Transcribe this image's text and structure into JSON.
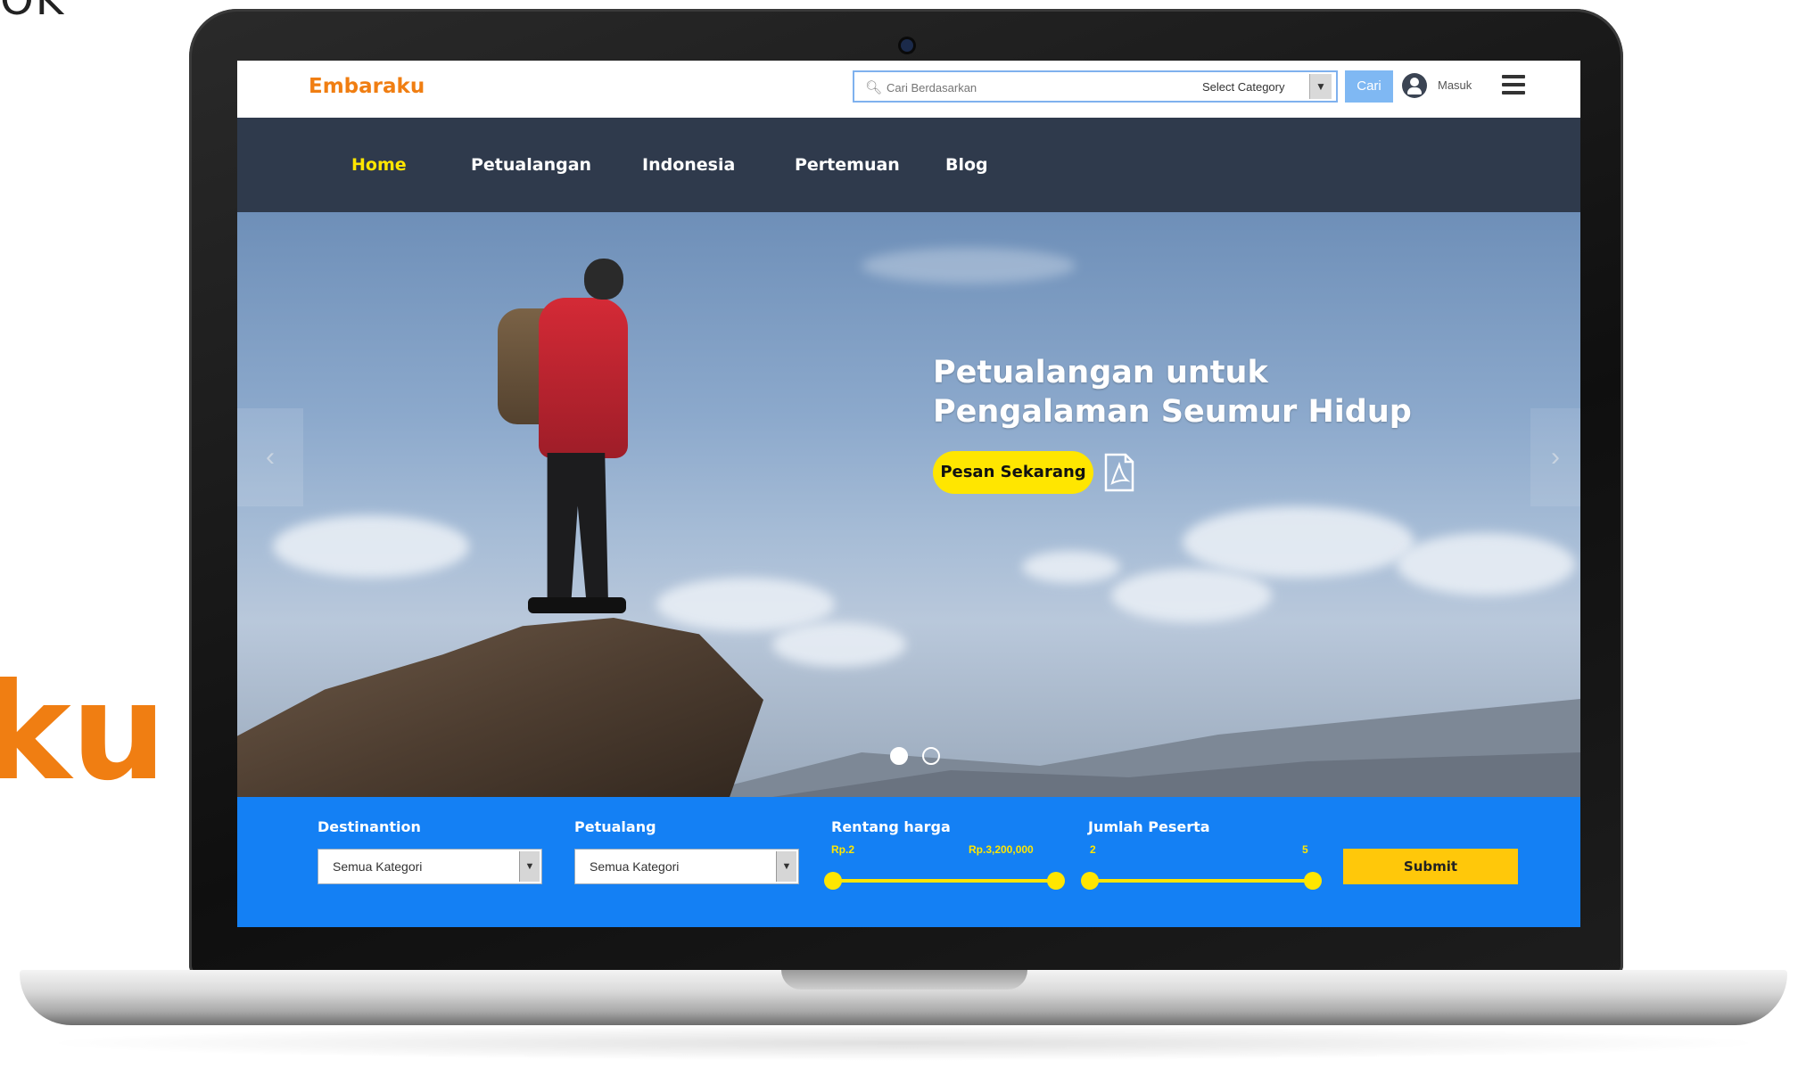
{
  "background": {
    "text_top": "OK",
    "text_brand_fragment": "ku"
  },
  "header": {
    "logo": "Embaraku",
    "search": {
      "placeholder": "Cari Berdasarkan",
      "category_label": "Select Category",
      "button_label": "Cari"
    },
    "login_label": "Masuk"
  },
  "nav": {
    "items": [
      {
        "label": "Home",
        "active": true
      },
      {
        "label": "Petualangan",
        "active": false
      },
      {
        "label": "Indonesia",
        "active": false
      },
      {
        "label": "Pertemuan",
        "active": false
      },
      {
        "label": "Blog",
        "active": false
      }
    ]
  },
  "hero": {
    "title_line1": "Petualangan untuk",
    "title_line2": "Pengalaman Seumur Hidup",
    "cta_label": "Pesan Sekarang",
    "arrow_left": "‹",
    "arrow_right": "›",
    "slides": 2,
    "active_slide": 1
  },
  "filter": {
    "destination": {
      "label": "Destinantion",
      "value": "Semua Kategori"
    },
    "petualang": {
      "label": "Petualang",
      "value": "Semua Kategori"
    },
    "price": {
      "label": "Rentang harga",
      "min": "Rp.2",
      "max": "Rp.3,200,000"
    },
    "participants": {
      "label": "Jumlah Peserta",
      "min": "2",
      "max": "5"
    },
    "submit_label": "Submit"
  },
  "colors": {
    "brand_orange": "#f07e12",
    "nav_bg": "#2f3a4c",
    "accent_yellow": "#ffe600",
    "filter_blue": "#1480f4",
    "submit_yellow": "#ffc80a"
  }
}
